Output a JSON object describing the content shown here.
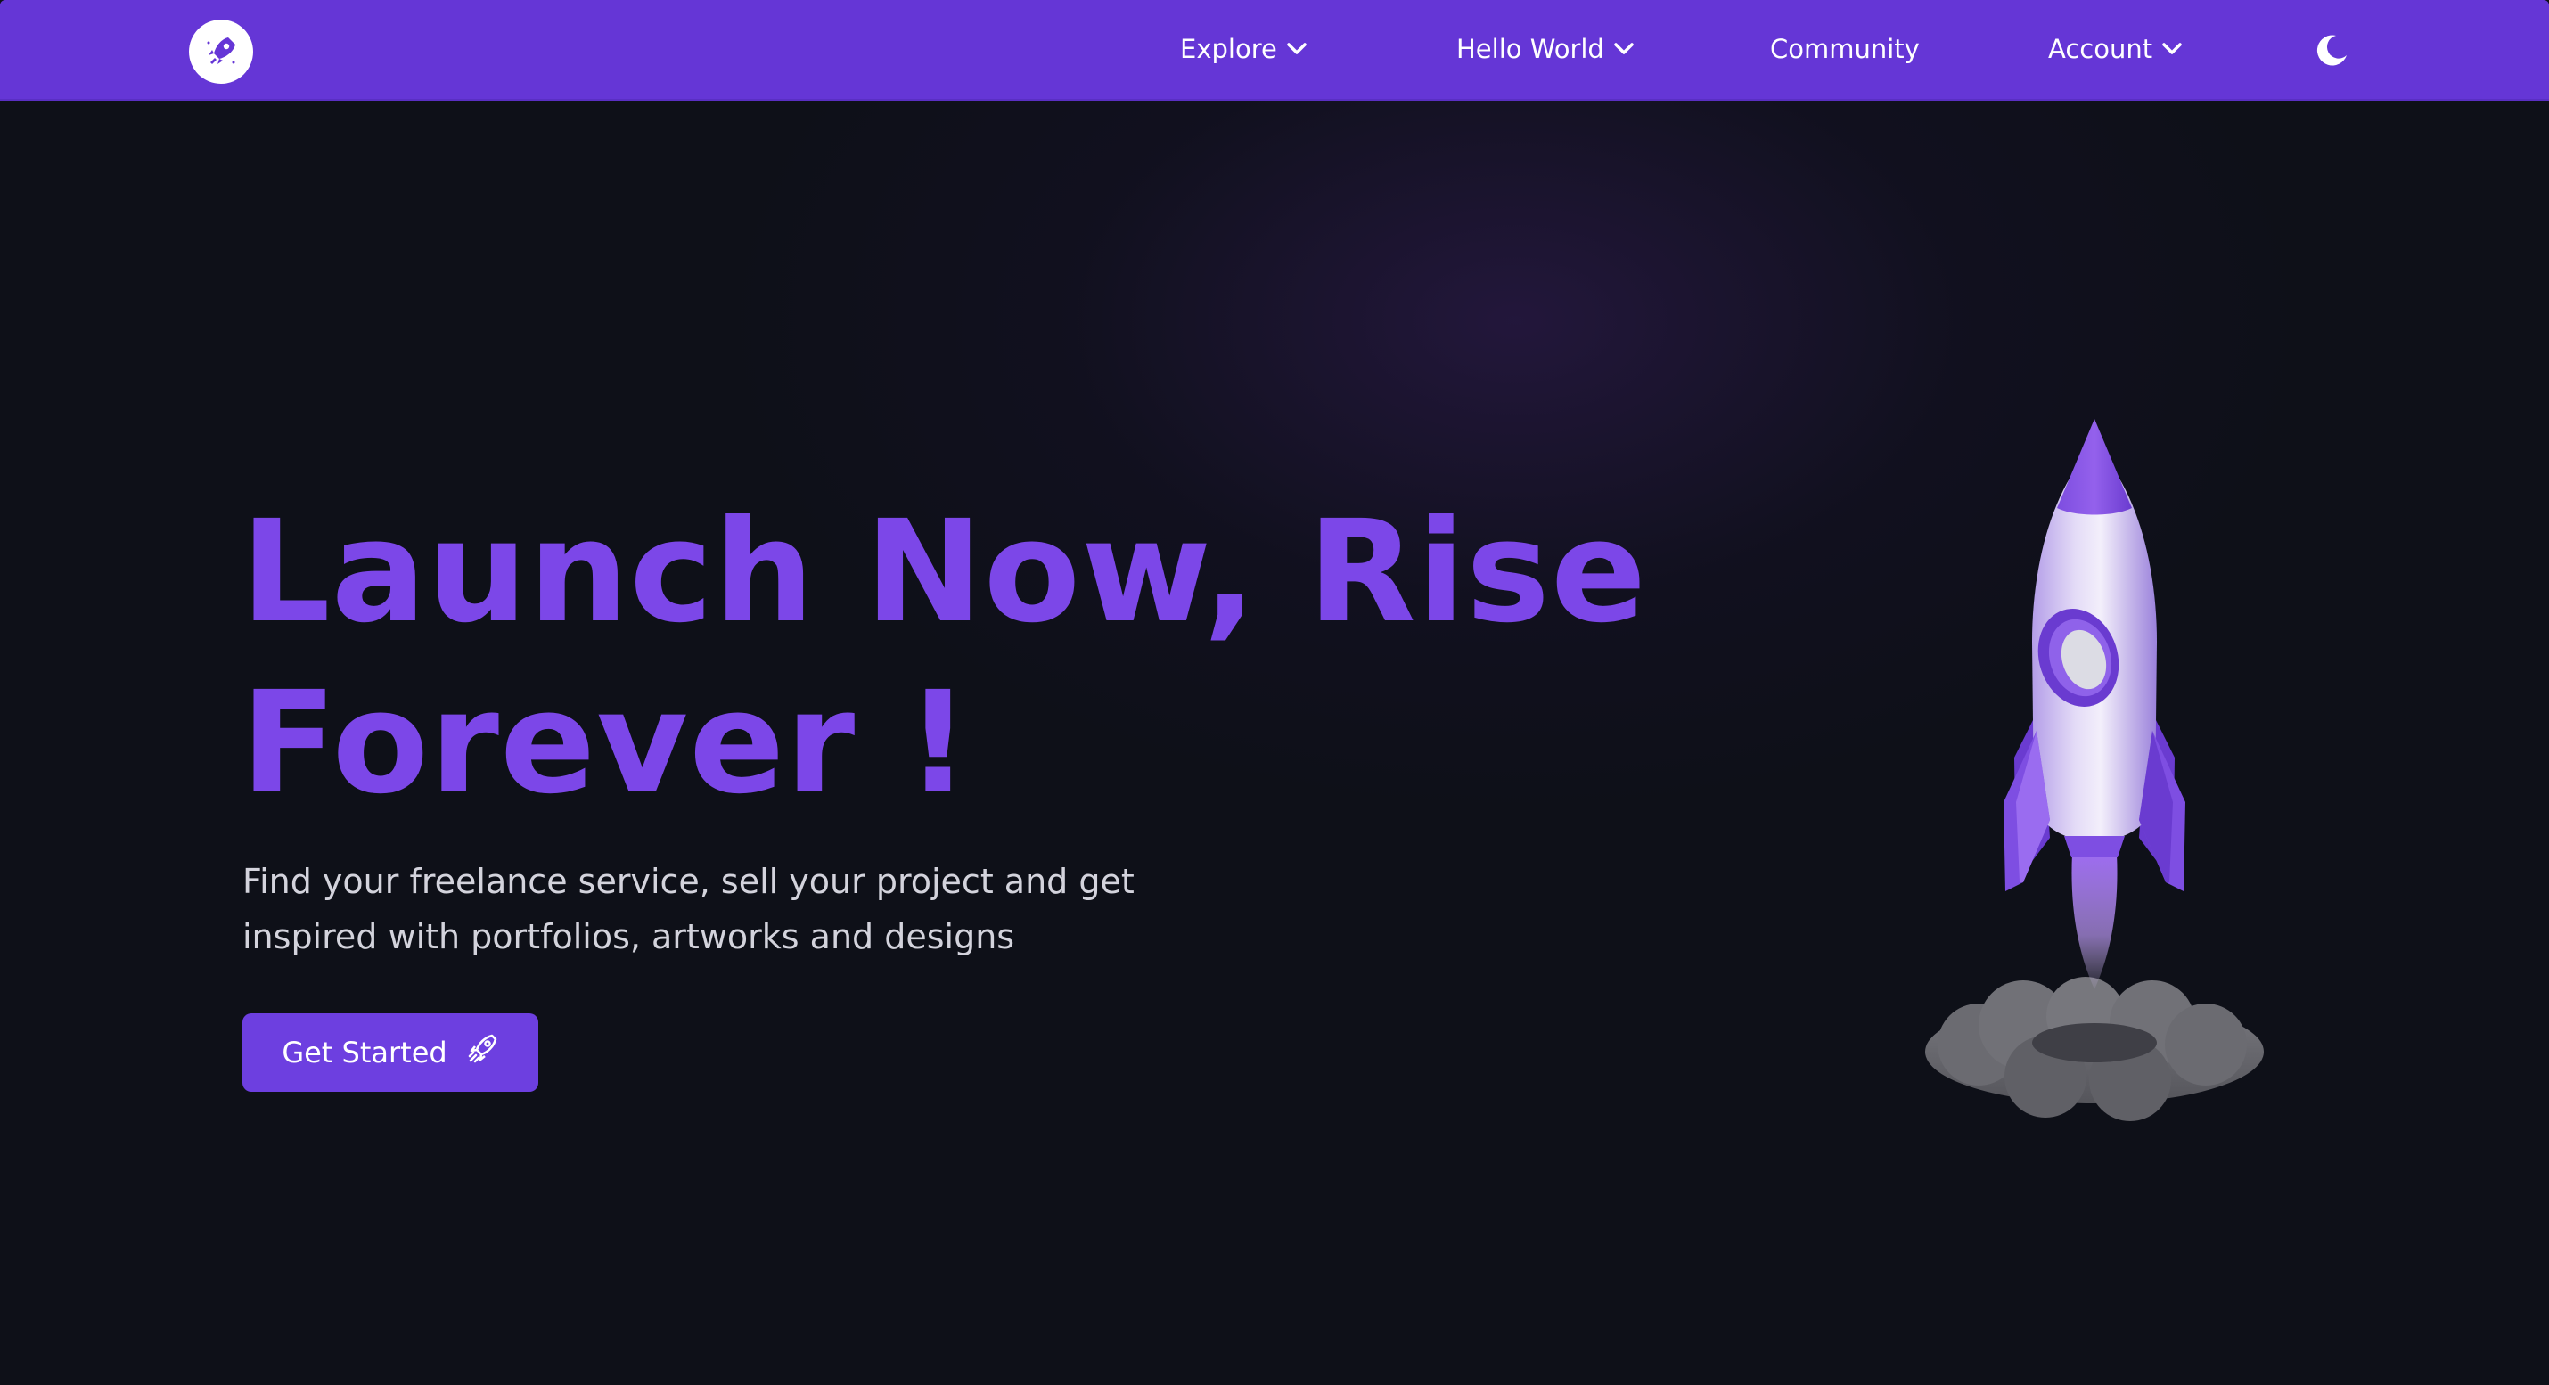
{
  "navbar": {
    "logo_icon": "rocket-logo-icon",
    "items": [
      {
        "label": "Explore",
        "has_dropdown": true
      },
      {
        "label": "Hello World",
        "has_dropdown": true
      },
      {
        "label": "Community",
        "has_dropdown": false
      },
      {
        "label": "Account",
        "has_dropdown": true
      }
    ],
    "theme_toggle_icon": "moon-icon",
    "background_color": "#6536d6"
  },
  "hero": {
    "title_line1": "Launch Now, Rise",
    "title_line2": "Forever !",
    "subtitle_line1": "Find your freelance service, sell your project and get",
    "subtitle_line2": "inspired with portfolios, artworks and designs",
    "cta_label": "Get Started",
    "cta_icon": "rocket-icon",
    "illustration": "rocket-launch-illustration"
  },
  "colors": {
    "accent": "#7c47e8",
    "button": "#6d3fe0",
    "background": "#0e1018"
  }
}
